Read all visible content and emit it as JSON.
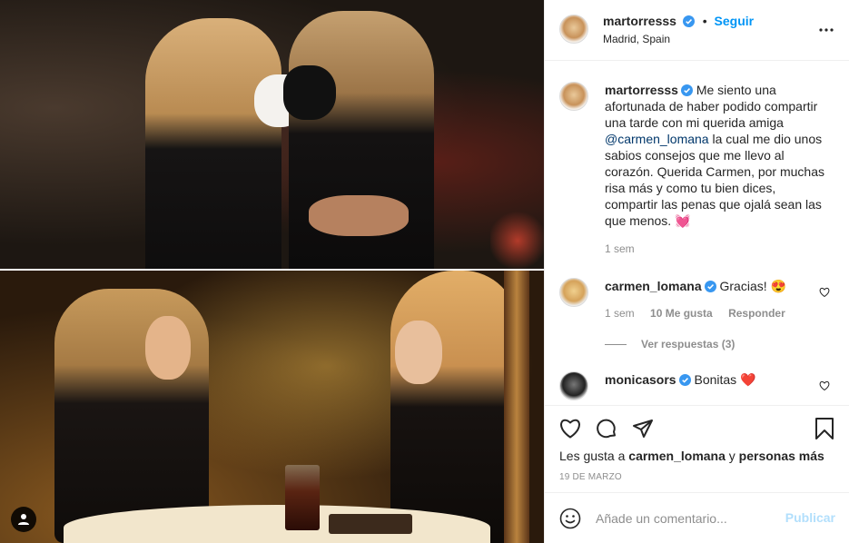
{
  "post": {
    "author": "martorresss",
    "follow_label": "Seguir",
    "dot": "•",
    "location": "Madrid, Spain",
    "caption": {
      "author": "martorresss",
      "text_before_mention": "Me siento una afortunada de haber podido compartir una tarde con mi querida amiga ",
      "mention": "@carmen_lomana",
      "text_after_mention": " la cual me dio unos sabios consejos que me llevo al corazón. Querida Carmen, por muchas risa más y como tu bien dices, compartir las penas que ojalá sean las que menos. 💓",
      "time": "1 sem"
    },
    "comments": [
      {
        "author": "carmen_lomana",
        "text": "Gracias! 😍",
        "time": "1 sem",
        "likes": "10 Me gusta",
        "reply_label": "Responder",
        "view_replies": "Ver respuestas (3)"
      },
      {
        "author": "monicasors",
        "text": "Bonitas ❤️"
      }
    ],
    "likes_prefix": "Les gusta a ",
    "likes_user": "carmen_lomana",
    "likes_middle": " y ",
    "likes_suffix": "personas más",
    "date": "19 DE MARZO",
    "comment_placeholder": "Añade un comentario...",
    "publish_label": "Publicar"
  },
  "icons": {
    "verified": "verified-badge-icon",
    "more": "more-options-icon",
    "heart": "heart-icon",
    "comment": "comment-icon",
    "share": "share-icon",
    "save": "bookmark-icon",
    "emoji": "emoji-icon",
    "user_tag": "user-tag-icon"
  },
  "colors": {
    "accent": "#0095f6",
    "verified": "#3897f0",
    "muted": "#8e8e8e",
    "mention": "#00376b",
    "publish_disabled": "#b2dffc"
  }
}
